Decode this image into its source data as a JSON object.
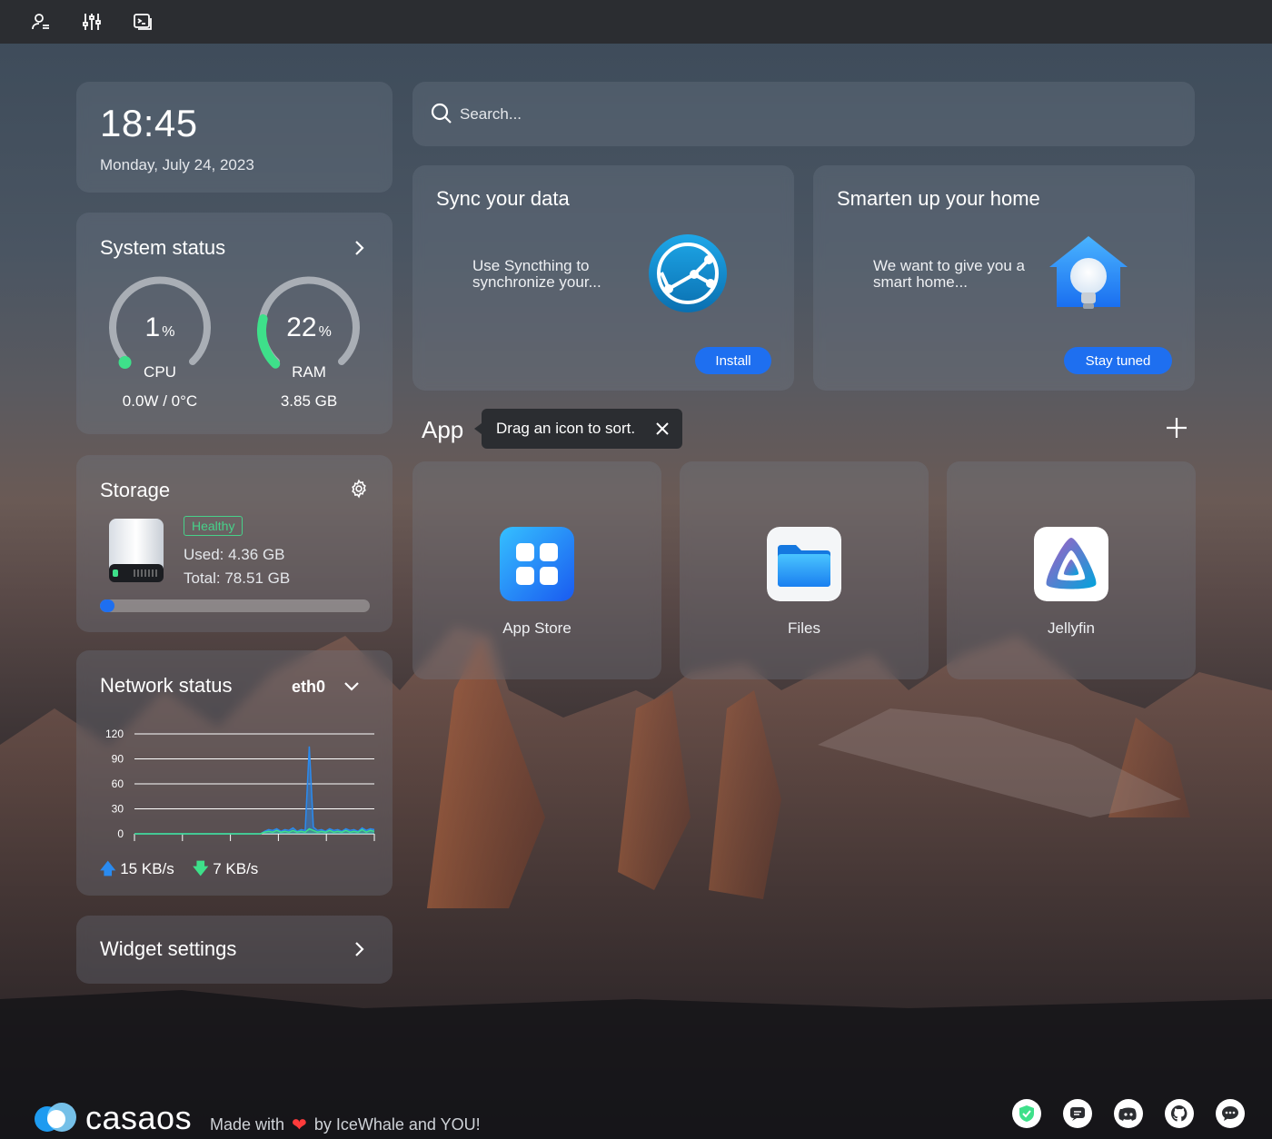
{
  "clock": {
    "time": "18:45",
    "date": "Monday, July 24, 2023"
  },
  "system": {
    "title": "System status",
    "cpu": {
      "value": "1",
      "unit": "%",
      "label": "CPU",
      "sub": "0.0W / 0°C",
      "percent": 1
    },
    "ram": {
      "value": "22",
      "unit": "%",
      "label": "RAM",
      "sub": "3.85 GB",
      "percent": 22
    }
  },
  "storage": {
    "title": "Storage",
    "health": "Healthy",
    "used": "Used: 4.36 GB",
    "total": "Total: 78.51 GB",
    "used_fraction": 0.0555
  },
  "network": {
    "title": "Network status",
    "interface": "eth0",
    "upload": "15 KB/s",
    "download": "7 KB/s"
  },
  "chart_data": {
    "type": "area",
    "title": "",
    "xlabel": "",
    "ylabel": "",
    "ylim": [
      0,
      120
    ],
    "yticks": [
      "120",
      "90",
      "60",
      "30",
      "0"
    ],
    "series": [
      {
        "values": [
          0,
          0,
          0,
          0,
          0,
          0,
          0,
          0,
          0,
          0,
          0,
          0,
          0,
          0,
          0,
          0,
          0,
          0,
          0,
          0,
          0,
          0,
          0,
          0,
          0,
          0,
          0,
          0,
          0,
          0,
          0,
          0,
          3,
          5,
          4,
          6,
          3,
          5,
          4,
          7,
          3,
          5,
          4,
          105,
          8,
          4,
          5,
          3,
          6,
          4,
          5,
          3,
          6,
          4,
          5,
          3,
          7,
          4,
          6,
          5
        ]
      },
      {
        "values": [
          0,
          0,
          0,
          0,
          0,
          0,
          0,
          0,
          0,
          0,
          0,
          0,
          0,
          0,
          0,
          0,
          0,
          0,
          0,
          0,
          0,
          0,
          0,
          0,
          0,
          0,
          0,
          0,
          0,
          0,
          0,
          0,
          2,
          3,
          2,
          4,
          2,
          3,
          2,
          4,
          2,
          3,
          2,
          6,
          4,
          2,
          3,
          2,
          4,
          2,
          3,
          2,
          4,
          2,
          3,
          2,
          5,
          2,
          4,
          3
        ]
      }
    ]
  },
  "widget": {
    "title": "Widget settings"
  },
  "search": {
    "placeholder": "Search..."
  },
  "promos": [
    {
      "title": "Sync your data",
      "desc": "Use Syncthing to synchronize your...",
      "button": "Install"
    },
    {
      "title": "Smarten up your home",
      "desc": "We want to give you a smart home...",
      "button": "Stay tuned"
    }
  ],
  "apps": {
    "title": "App",
    "hint": "Drag an icon to sort.",
    "items": [
      {
        "label": "App Store",
        "icon": "app-store-icon"
      },
      {
        "label": "Files",
        "icon": "files-icon"
      },
      {
        "label": "Jellyfin",
        "icon": "jellyfin-icon"
      }
    ]
  },
  "footer": {
    "brand": "casaos",
    "made_prefix": "Made with",
    "made_suffix": "by IceWhale and YOU!"
  },
  "colors": {
    "accent": "#1e6ff0",
    "healthy": "#47d18a",
    "topbar": "#2b2d31",
    "ram_arc": "#3ee08a"
  }
}
